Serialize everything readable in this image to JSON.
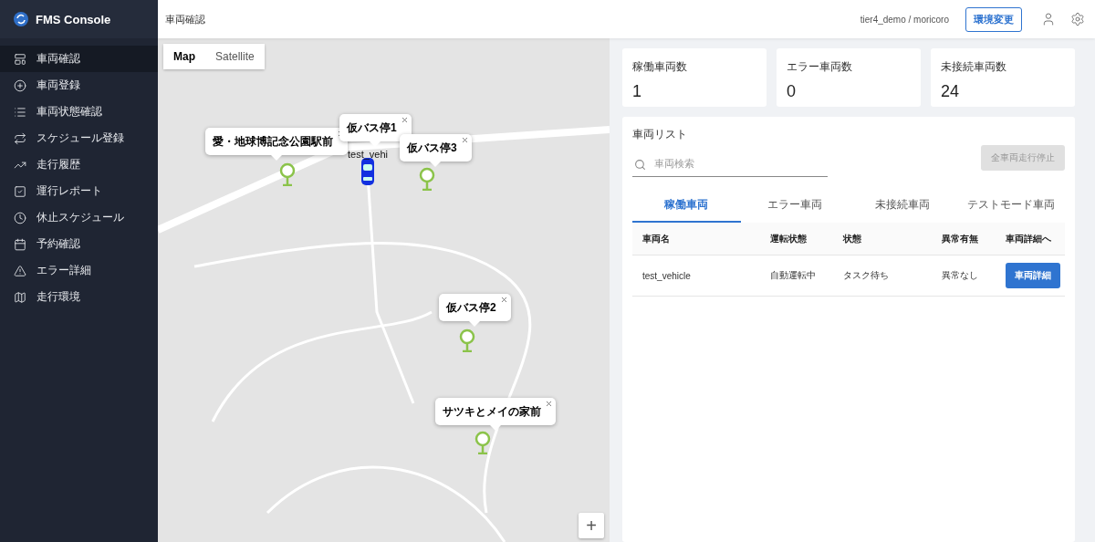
{
  "app": {
    "title": "FMS Console"
  },
  "sidebar": {
    "items": [
      {
        "label": "車両確認",
        "selected": true
      },
      {
        "label": "車両登録",
        "selected": false
      },
      {
        "label": "車両状態確認",
        "selected": false
      },
      {
        "label": "スケジュール登録",
        "selected": false
      },
      {
        "label": "走行履歴",
        "selected": false
      },
      {
        "label": "運行レポート",
        "selected": false
      },
      {
        "label": "休止スケジュール",
        "selected": false
      },
      {
        "label": "予約確認",
        "selected": false
      },
      {
        "label": "エラー詳細",
        "selected": false
      },
      {
        "label": "走行環境",
        "selected": false
      }
    ]
  },
  "header": {
    "title": "車両確認",
    "account": "tier4_demo / moricoro",
    "env_button": "環境変更"
  },
  "map": {
    "map_types": [
      {
        "label": "Map",
        "selected": true
      },
      {
        "label": "Satellite",
        "selected": false
      }
    ],
    "stops": [
      {
        "label": "愛・地球博記念公園駅前"
      },
      {
        "label": "仮バス停1"
      },
      {
        "label": "仮バス停3"
      },
      {
        "label": "仮バス停2"
      },
      {
        "label": "サツキとメイの家前"
      }
    ],
    "vehicle_label": "test_vehi",
    "zoom_in": "+"
  },
  "stats": [
    {
      "label": "稼働車両数",
      "value": "1"
    },
    {
      "label": "エラー車両数",
      "value": "0"
    },
    {
      "label": "未接続車両数",
      "value": "24"
    }
  ],
  "vehicle_list": {
    "title": "車両リスト",
    "search": {
      "placeholder": "車両検索"
    },
    "stop_all": {
      "label": "全車両走行停止",
      "disabled": true
    },
    "tabs": [
      {
        "label": "稼働車両",
        "selected": true
      },
      {
        "label": "エラー車両",
        "selected": false
      },
      {
        "label": "未接続車両",
        "selected": false
      },
      {
        "label": "テストモード車両",
        "selected": false
      }
    ],
    "columns": [
      "車両名",
      "運転状態",
      "状態",
      "異常有無",
      "車両詳細へ"
    ],
    "rows": [
      {
        "name": "test_vehicle",
        "driving": "自動運転中",
        "status": "タスク待ち",
        "anomaly": "異常なし",
        "button": "車両詳細"
      }
    ]
  }
}
